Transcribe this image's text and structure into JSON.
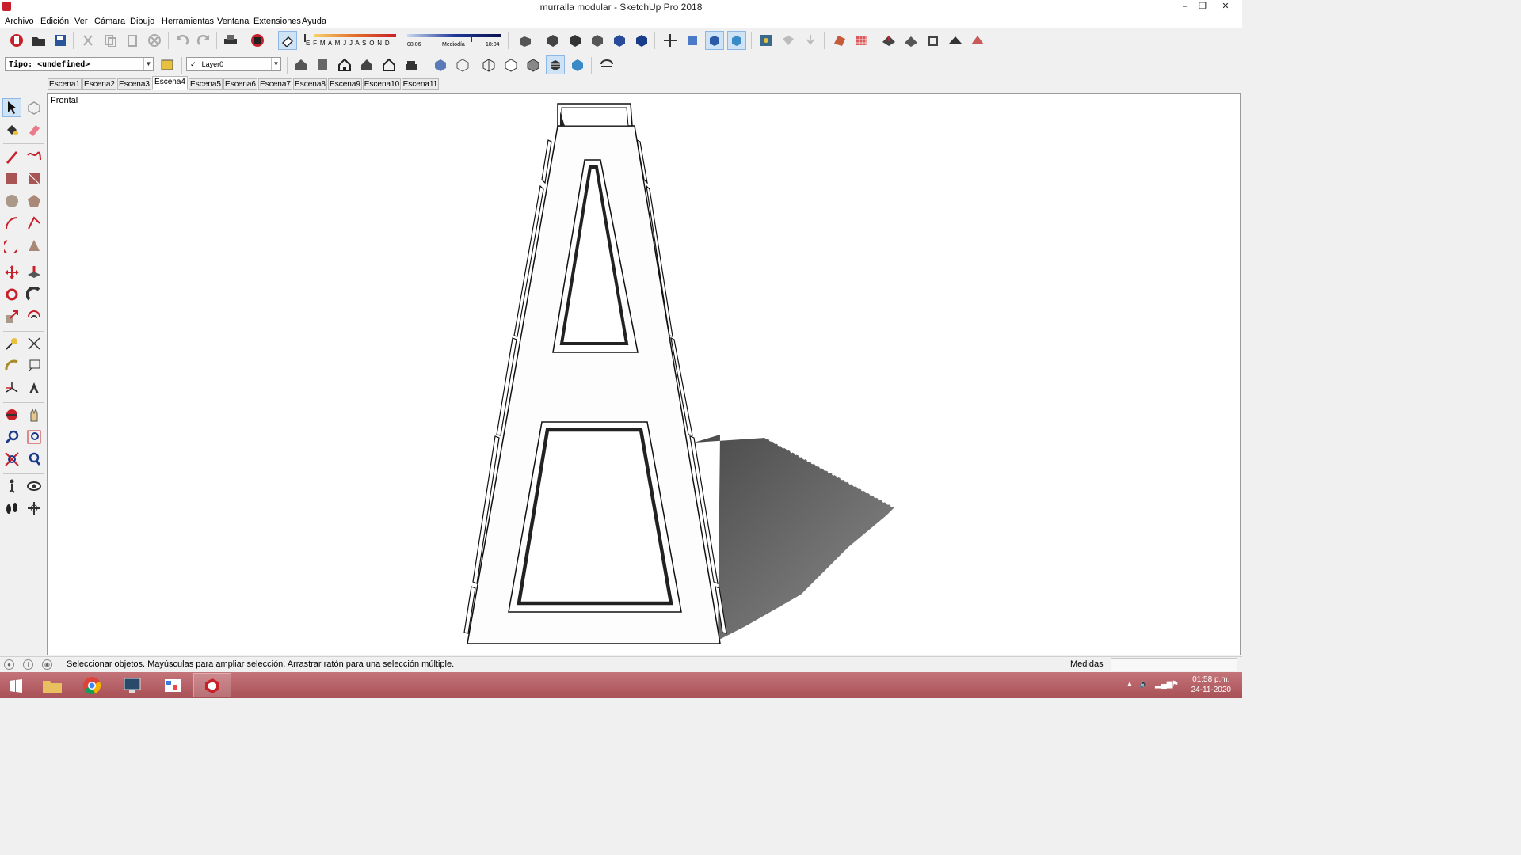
{
  "window": {
    "title": "murralla modular - SketchUp Pro 2018",
    "minimize": "–",
    "restore": "❐",
    "close": "✕"
  },
  "menu": [
    "Archivo",
    "Edición",
    "Ver",
    "Cámara",
    "Dibujo",
    "Herramientas",
    "Ventana",
    "Extensiones",
    "Ayuda"
  ],
  "shadow_bar": {
    "months": "E F M A M J J A S O N D",
    "time_start": "08:06",
    "time_mid": "Mediodía",
    "time_end": "18:04"
  },
  "type_combo": {
    "value": "Tipo: <undefined>"
  },
  "layer_combo": {
    "check": "✓",
    "value": "Layer0"
  },
  "scenes": [
    "Escena1",
    "Escena2",
    "Escena3",
    "Escena4",
    "Escena5",
    "Escena6",
    "Escena7",
    "Escena8",
    "Escena9",
    "Escena10",
    "Escena11"
  ],
  "active_scene": "Escena4",
  "viewport": {
    "label": "Frontal"
  },
  "status": {
    "message": "Seleccionar objetos. Mayúsculas para ampliar selección. Arrastrar ratón para una selección múltiple.",
    "measure_label": "Medidas",
    "measure_value": ""
  },
  "clock": {
    "time": "01:58 p.m.",
    "date": "24-11-2020"
  },
  "colors": {
    "taskbar": "#b0585e",
    "accent": "#cfe3f7",
    "sketchup_red": "#c8202a"
  }
}
